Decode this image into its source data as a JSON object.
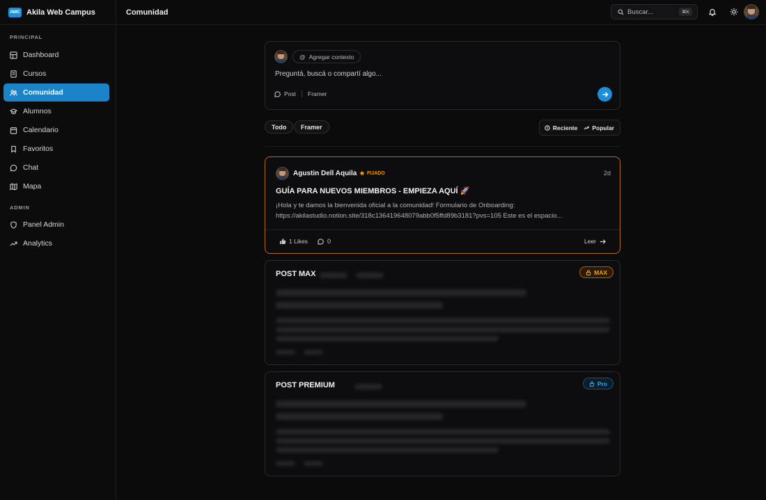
{
  "app": {
    "logo_text": "AWC",
    "name": "Akila Web Campus"
  },
  "sidebar": {
    "section_principal": "PRINCIPAL",
    "section_admin": "ADMIN",
    "principal_items": [
      {
        "label": "Dashboard",
        "icon": "dashboard-icon"
      },
      {
        "label": "Cursos",
        "icon": "book-icon"
      },
      {
        "label": "Comunidad",
        "icon": "people-icon",
        "active": true
      },
      {
        "label": "Alumnos",
        "icon": "graduation-cap-icon"
      },
      {
        "label": "Calendario",
        "icon": "calendar-icon"
      },
      {
        "label": "Favoritos",
        "icon": "bookmark-icon"
      },
      {
        "label": "Chat",
        "icon": "chat-bubble-icon"
      },
      {
        "label": "Mapa",
        "icon": "map-icon"
      }
    ],
    "admin_items": [
      {
        "label": "Panel Admin",
        "icon": "shield-icon"
      },
      {
        "label": "Analytics",
        "icon": "trending-up-icon"
      }
    ]
  },
  "header": {
    "title": "Comunidad",
    "search_placeholder": "Buscar...",
    "search_shortcut": "⌘K"
  },
  "composer": {
    "context_chip": "Agregar contexto",
    "placeholder": "Preguntá, buscá o compartí algo...",
    "type_label": "Post",
    "channel_label": "Framer"
  },
  "filters": {
    "tabs": [
      "Todo",
      "Framer"
    ],
    "sort_recent": "Reciente",
    "sort_popular": "Popular"
  },
  "pinned_post": {
    "author": "Agustin Dell Aquila",
    "badge": "FIJADO",
    "time": "2d",
    "title": "GUÍA PARA NUEVOS MIEMBROS - EMPIEZA AQUÍ 🚀",
    "excerpt_line1": "¡Hola y te damos la bienvenida oficial a la comunidad! Formulario de Onboarding:",
    "excerpt_line2": "https://akilastudio.notion.site/318c136419648079abb0f5ffd89b3181?pvs=105 Este es el espacio...",
    "likes": "1 Likes",
    "comments": "0",
    "read_more": "Leer"
  },
  "locked_posts": [
    {
      "title": "POST MAX",
      "tier": "MAX"
    },
    {
      "title": "POST PREMIUM",
      "tier": "Pro"
    }
  ],
  "colors": {
    "accent": "#1b83c8",
    "pinned": "#f59e0b",
    "background": "#0b0b0c"
  }
}
